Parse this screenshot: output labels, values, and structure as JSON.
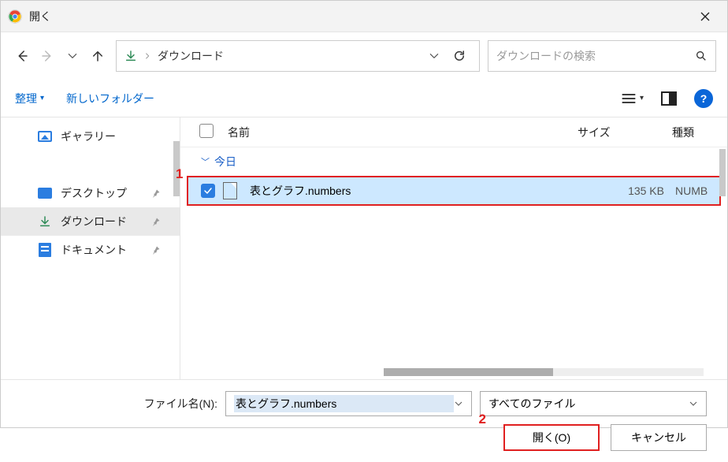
{
  "titlebar": {
    "title": "開く"
  },
  "nav": {
    "current_folder": "ダウンロード",
    "search_placeholder": "ダウンロードの検索"
  },
  "toolbar": {
    "organize": "整理",
    "new_folder": "新しいフォルダー"
  },
  "sidebar": {
    "items": [
      {
        "label": "ギャラリー",
        "pinned": false
      },
      {
        "label": "デスクトップ",
        "pinned": true
      },
      {
        "label": "ダウンロード",
        "pinned": true,
        "active": true
      },
      {
        "label": "ドキュメント",
        "pinned": true
      }
    ]
  },
  "filelist": {
    "headers": {
      "name": "名前",
      "size": "サイズ",
      "type": "種類"
    },
    "group": "今日",
    "rows": [
      {
        "name": "表とグラフ.numbers",
        "size": "135 KB",
        "type": "NUMB",
        "selected": true
      }
    ]
  },
  "footer": {
    "filename_label": "ファイル名(N):",
    "filename_value": "表とグラフ.numbers",
    "filter": "すべてのファイル",
    "open": "開く(O)",
    "cancel": "キャンセル"
  },
  "annotations": {
    "one": "1",
    "two": "2"
  }
}
